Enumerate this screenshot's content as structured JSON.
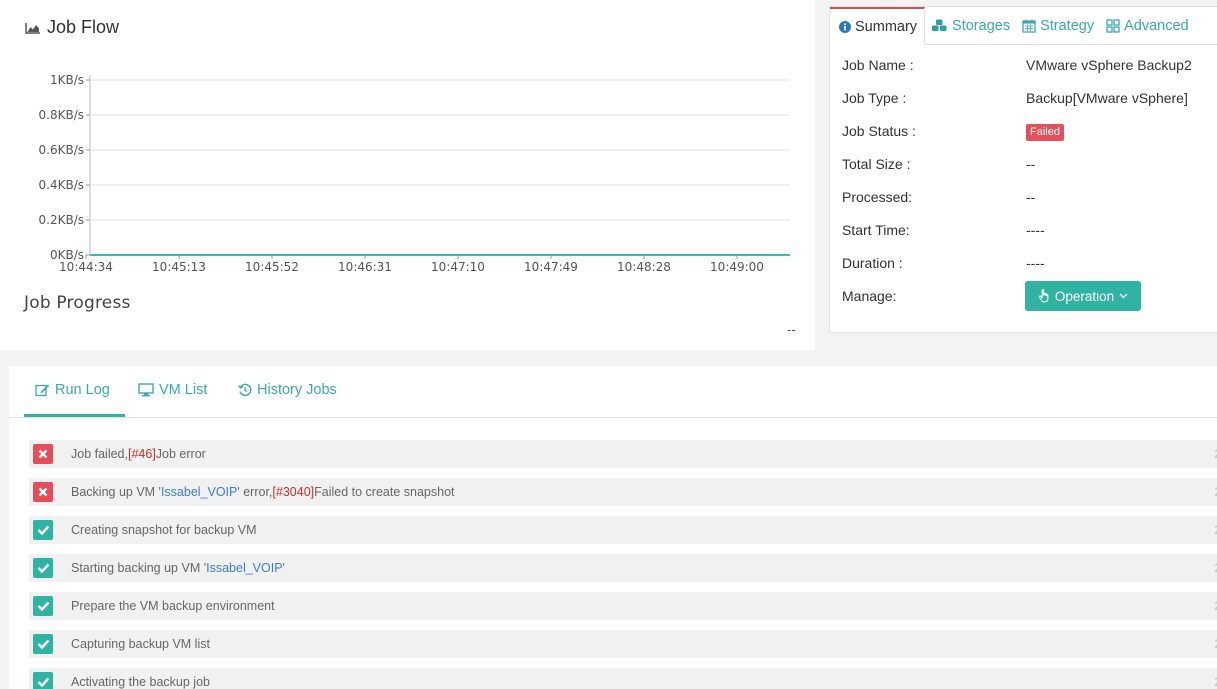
{
  "flow": {
    "title": "Job Flow",
    "progress_title": "Job Progress",
    "progress_value": "--"
  },
  "chart_data": {
    "type": "line",
    "title": "",
    "xlabel": "",
    "ylabel": "",
    "y_tick_labels": [
      "0KB/s",
      "0.2KB/s",
      "0.4KB/s",
      "0.6KB/s",
      "0.8KB/s",
      "1KB/s"
    ],
    "y_ticks": [
      0,
      0.2,
      0.4,
      0.6,
      0.8,
      1
    ],
    "ylim": [
      0,
      1
    ],
    "x_tick_labels": [
      "10:44:34",
      "10:45:13",
      "10:45:52",
      "10:46:31",
      "10:47:10",
      "10:47:49",
      "10:48:28",
      "10:49:00"
    ],
    "x": [
      "10:44:34",
      "10:49:00"
    ],
    "grid": true,
    "series": [
      {
        "values": [
          0,
          0
        ],
        "color": "#3fb8b0"
      }
    ]
  },
  "summary": {
    "tabs": [
      {
        "label": "Summary",
        "icon": "info-circle-icon",
        "active": true
      },
      {
        "label": "Storages",
        "icon": "cubes-icon",
        "active": false
      },
      {
        "label": "Strategy",
        "icon": "calendar-icon",
        "active": false
      },
      {
        "label": "Advanced",
        "icon": "grid-icon",
        "active": false
      }
    ],
    "rows": [
      {
        "key": "Job Name :",
        "value": "VMware vSphere Backup2"
      },
      {
        "key": "Job Type :",
        "value": "Backup[VMware vSphere]"
      },
      {
        "key": "Job Status :",
        "value": "Failed"
      },
      {
        "key": "Total Size :",
        "value": "--"
      },
      {
        "key": "Processed:",
        "value": "--"
      },
      {
        "key": "Start Time:",
        "value": "----"
      },
      {
        "key": "Duration :",
        "value": "----"
      },
      {
        "key": "Manage:",
        "value": ""
      }
    ],
    "operation_label": "Operation"
  },
  "log": {
    "tabs": [
      {
        "label": "Run Log",
        "icon": "edit-icon",
        "active": true
      },
      {
        "label": "VM List",
        "icon": "monitor-icon",
        "active": false
      },
      {
        "label": "History Jobs",
        "icon": "history-icon",
        "active": false
      }
    ],
    "entries": [
      {
        "status": "error",
        "parts": [
          {
            "t": "Job failed,",
            "c": ""
          },
          {
            "t": "[#46]",
            "c": "red"
          },
          {
            "t": "Job error",
            "c": ""
          }
        ],
        "time": "2"
      },
      {
        "status": "error",
        "parts": [
          {
            "t": "Backing up VM '",
            "c": ""
          },
          {
            "t": "Issabel_VOIP",
            "c": "blue"
          },
          {
            "t": "' error,",
            "c": ""
          },
          {
            "t": "[#3040]",
            "c": "red"
          },
          {
            "t": "Failed to create snapshot",
            "c": ""
          }
        ],
        "time": "2"
      },
      {
        "status": "ok",
        "parts": [
          {
            "t": "Creating snapshot for backup VM",
            "c": ""
          }
        ],
        "time": "2"
      },
      {
        "status": "ok",
        "parts": [
          {
            "t": "Starting backing up VM '",
            "c": ""
          },
          {
            "t": "Issabel_VOIP",
            "c": "blue"
          },
          {
            "t": "'",
            "c": ""
          }
        ],
        "time": "2"
      },
      {
        "status": "ok",
        "parts": [
          {
            "t": "Prepare the VM backup environment",
            "c": ""
          }
        ],
        "time": "2"
      },
      {
        "status": "ok",
        "parts": [
          {
            "t": "Capturing backup VM list",
            "c": ""
          }
        ],
        "time": "2"
      },
      {
        "status": "ok",
        "parts": [
          {
            "t": "Activating the backup job",
            "c": ""
          }
        ],
        "time": "2"
      }
    ]
  },
  "colors": {
    "accent": "#2fb3a3",
    "link": "#3ba7b6",
    "error": "#e74c5a"
  }
}
